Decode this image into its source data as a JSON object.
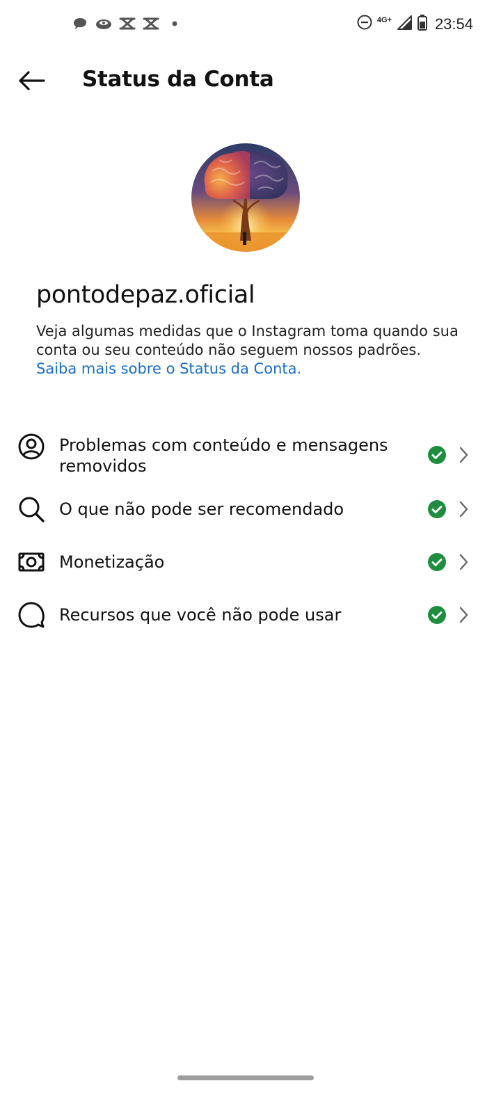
{
  "status_bar": {
    "time": "23:54",
    "network": "4G+",
    "icons_left": [
      "chat-bubble-icon",
      "eye-cloud-icon",
      "capcut-icon",
      "capcut-icon",
      "dot-icon"
    ],
    "icons_right": [
      "do-not-disturb-icon",
      "signal-icon",
      "battery-icon"
    ]
  },
  "header": {
    "back_icon": "arrow-left-icon",
    "title": "Status da Conta"
  },
  "profile": {
    "avatar": "brain-tree-sunset-image",
    "username": "pontodepaz.oficial",
    "description": "Veja algumas medidas que o Instagram toma quando sua conta ou seu conteúdo não seguem nossos padrões.",
    "learn_more": "Saiba mais sobre o Status da Conta."
  },
  "status_items": [
    {
      "icon": "user-circle-icon",
      "label": "Problemas com conteúdo e mensagens removidos",
      "status": "ok"
    },
    {
      "icon": "search-icon",
      "label": "O que não pode ser recomendado",
      "status": "ok"
    },
    {
      "icon": "money-icon",
      "label": "Monetização",
      "status": "ok"
    },
    {
      "icon": "speech-bubble-icon",
      "label": "Recursos que você não pode usar",
      "status": "ok"
    }
  ],
  "colors": {
    "check_green": "#1e8e3e",
    "link_blue": "#1a6fc4"
  }
}
